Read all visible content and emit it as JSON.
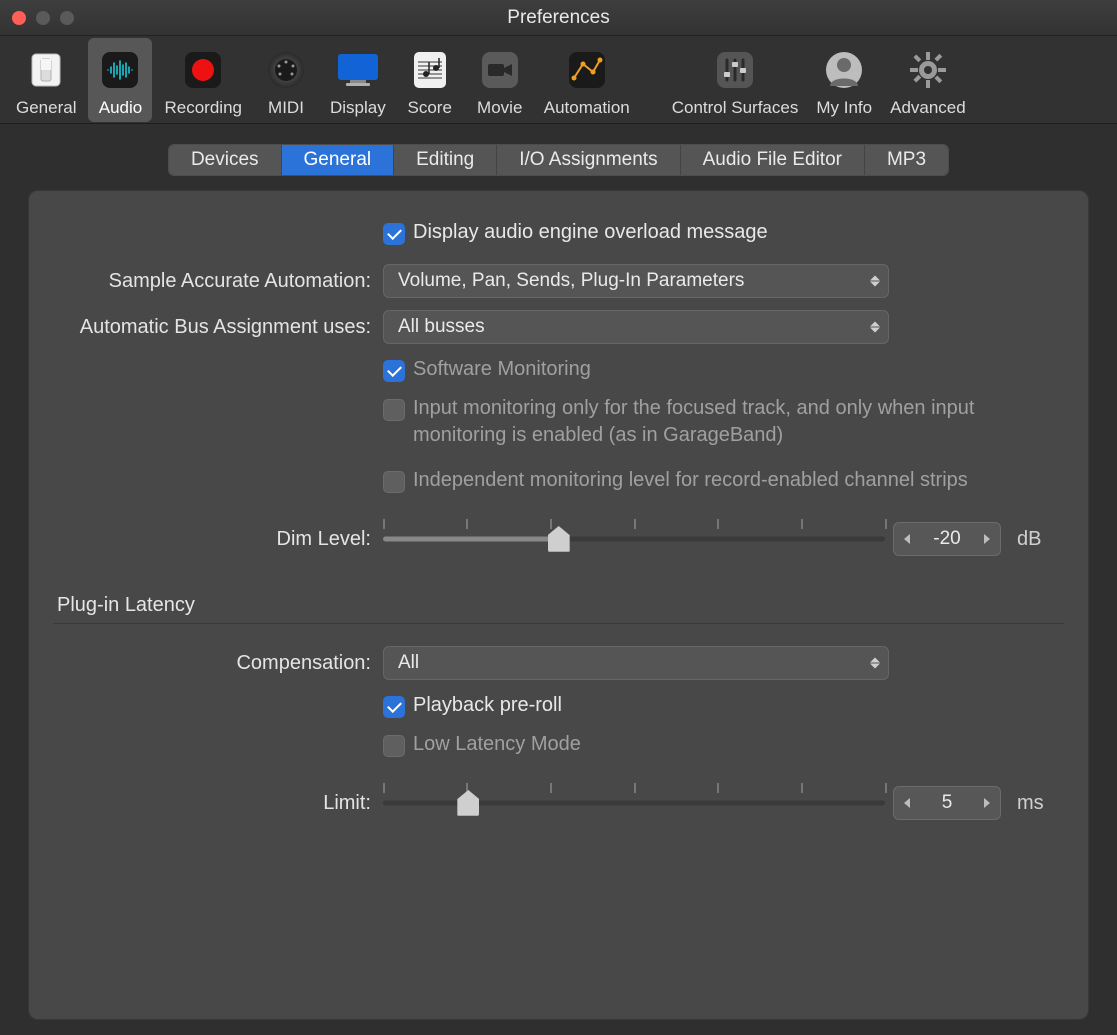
{
  "window": {
    "title": "Preferences"
  },
  "toolbar": {
    "items": [
      {
        "name": "general",
        "label": "General"
      },
      {
        "name": "audio",
        "label": "Audio",
        "selected": true
      },
      {
        "name": "recording",
        "label": "Recording"
      },
      {
        "name": "midi",
        "label": "MIDI"
      },
      {
        "name": "display",
        "label": "Display"
      },
      {
        "name": "score",
        "label": "Score"
      },
      {
        "name": "movie",
        "label": "Movie"
      },
      {
        "name": "automation",
        "label": "Automation"
      },
      {
        "name": "control-surfaces",
        "label": "Control Surfaces"
      },
      {
        "name": "my-info",
        "label": "My Info"
      },
      {
        "name": "advanced",
        "label": "Advanced"
      }
    ]
  },
  "tabs": {
    "items": [
      {
        "name": "devices",
        "label": "Devices"
      },
      {
        "name": "general",
        "label": "General",
        "active": true
      },
      {
        "name": "editing",
        "label": "Editing"
      },
      {
        "name": "io-assignments",
        "label": "I/O Assignments"
      },
      {
        "name": "audio-file-editor",
        "label": "Audio File Editor"
      },
      {
        "name": "mp3",
        "label": "MP3"
      }
    ]
  },
  "form": {
    "display_overload": {
      "label": "Display audio engine overload message",
      "checked": true
    },
    "sample_accurate_automation": {
      "label": "Sample Accurate Automation:",
      "value": "Volume, Pan, Sends, Plug-In Parameters"
    },
    "automatic_bus_assignment": {
      "label": "Automatic Bus Assignment uses:",
      "value": "All busses"
    },
    "software_monitoring": {
      "label": "Software Monitoring",
      "checked": true
    },
    "input_monitoring_focused": {
      "label": "Input monitoring only for the focused track, and only when input monitoring is enabled (as in GarageBand)",
      "checked": false
    },
    "independent_monitoring": {
      "label": "Independent monitoring level for record-enabled channel strips",
      "checked": false
    },
    "dim_level": {
      "label": "Dim Level:",
      "value": "-20",
      "unit": "dB",
      "slider_percent": 35
    },
    "section_plugin_latency": "Plug-in Latency",
    "compensation": {
      "label": "Compensation:",
      "value": "All"
    },
    "playback_preroll": {
      "label": "Playback pre-roll",
      "checked": true
    },
    "low_latency_mode": {
      "label": "Low Latency Mode",
      "checked": false
    },
    "limit": {
      "label": "Limit:",
      "value": "5",
      "unit": "ms",
      "slider_percent": 17
    }
  }
}
